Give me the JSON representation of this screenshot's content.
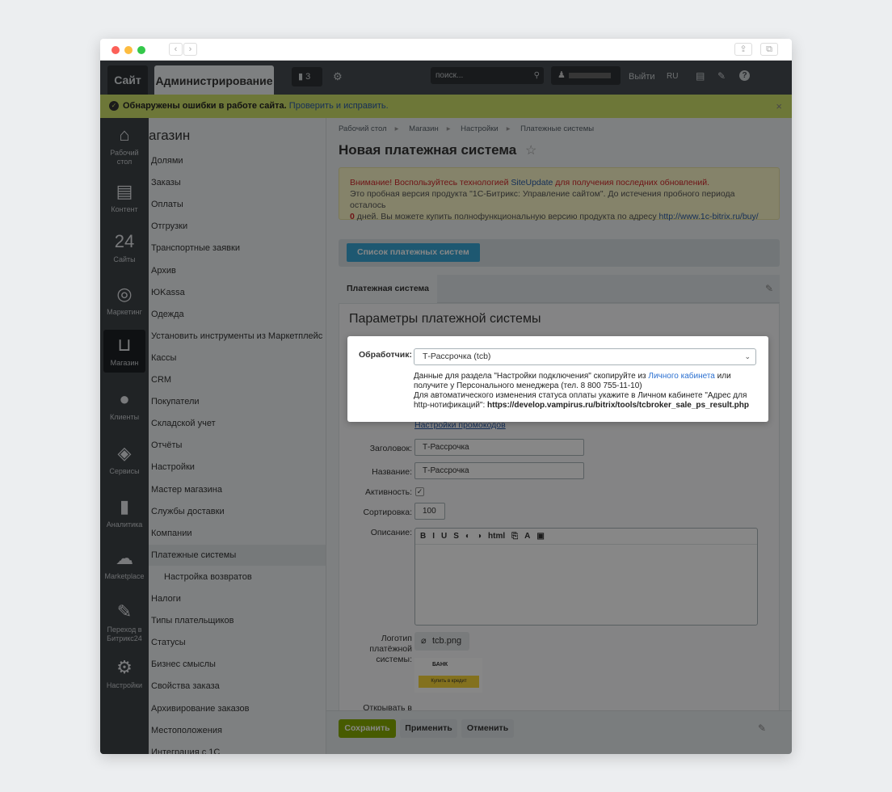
{
  "topnav": {
    "site": "Сайт",
    "admin": "Администрирование",
    "notifications_count": "3",
    "search_placeholder": "поиск...",
    "logout": "Выйти",
    "lang": "RU"
  },
  "alert": {
    "text": "Обнаружены ошибки в работе сайта.",
    "link": "Проверить и исправить.",
    "close": "×"
  },
  "left_nav": [
    {
      "label": "Рабочий стол",
      "icon": "home-icon",
      "glyph": "⌂"
    },
    {
      "label": "Контент",
      "icon": "document-icon",
      "glyph": "▤"
    },
    {
      "label": "Сайты",
      "icon": "calendar-icon",
      "glyph": "24"
    },
    {
      "label": "Маркетинг",
      "icon": "target-icon",
      "glyph": "◎"
    },
    {
      "label": "Магазин",
      "icon": "basket-icon",
      "glyph": "⊔"
    },
    {
      "label": "Клиенты",
      "icon": "clients-icon",
      "glyph": "●"
    },
    {
      "label": "Сервисы",
      "icon": "layers-icon",
      "glyph": "◈"
    },
    {
      "label": "Аналитика",
      "icon": "chart-icon",
      "glyph": "▮"
    },
    {
      "label": "Marketplace",
      "icon": "cloud-download-icon",
      "glyph": "☁"
    },
    {
      "label": "Переход в Битрикс24",
      "icon": "magic-wand-icon",
      "glyph": "✎"
    },
    {
      "label": "Настройки",
      "icon": "gear-icon",
      "glyph": "⚙"
    }
  ],
  "menu": {
    "title": "агазин",
    "items": [
      "Долями",
      "Заказы",
      "Оплаты",
      "Отгрузки",
      "Транспортные заявки",
      "Архив",
      "ЮKassa",
      "Одежда",
      "Установить инструменты из Маркетплейс",
      "Кассы",
      "CRM",
      "Покупатели",
      "Складской учет",
      "Отчёты",
      "Настройки",
      "Мастер магазина",
      "Службы доставки",
      "Компании",
      "Платежные системы",
      "Настройка возвратов",
      "Налоги",
      "Типы плательщиков",
      "Статусы",
      "Бизнес смыслы",
      "Свойства заказа",
      "Архивирование заказов",
      "Местоположения",
      "Интеграция с 1С"
    ]
  },
  "breadcrumb": [
    "Рабочий стол",
    "Магазин",
    "Настройки",
    "Платежные системы"
  ],
  "page_title": "Новая платежная система",
  "warning": {
    "l1a": "Внимание! Воспользуйтесь технологией ",
    "l1link": "SiteUpdate",
    "l1b": " для получения последних обновлений.",
    "l2": "Это пробная версия продукта \"1С-Битрикс: Управление сайтом\". До истечения пробного периода осталось",
    "days": "0",
    "l3": " дней. Вы можете купить полнофункциональную версию продукта по адресу ",
    "l3link": "http://www.1c-bitrix.ru/buy/"
  },
  "list_button": "Список платежных систем",
  "tab": "Платежная система",
  "panel_title": "Параметры платежной системы",
  "form": {
    "promo_link": "Настройки промокодов",
    "header_label": "Заголовок:",
    "header_value": "Т-Рассрочка",
    "name_label": "Название:",
    "name_value": "Т-Рассрочка",
    "active_label": "Активность:",
    "sort_label": "Сортировка:",
    "sort_value": "100",
    "desc_label": "Описание:",
    "editor_tools": [
      "B",
      "I",
      "U",
      "S",
      "◐",
      "◑",
      "html",
      "⎘",
      "A",
      "▣"
    ],
    "logo_label": "Логотип платёжной системы:",
    "logo_file": "tcb.png",
    "logo_bank": "БАНК",
    "logo_button": "Купить в кредит",
    "open_label": "Открывать в"
  },
  "popup": {
    "label": "Обработчик:",
    "value": "Т-Рассрочка (tcb)",
    "t1": "Данные для раздела \"Настройки подключения\" скопируйте из ",
    "t1link": "Личного кабинета",
    "t1b": " или получите у Персонального менеджера (тел. 8 800 755-11-10)",
    "t2": "Для автоматического изменения статуса оплаты укажите в Личном кабинете \"Адрес для http-нотификаций\": ",
    "t2url": "https://develop.vampirus.ru/bitrix/tools/tcbroker_sale_ps_result.php"
  },
  "footer": {
    "save": "Сохранить",
    "apply": "Применить",
    "cancel": "Отменить"
  }
}
